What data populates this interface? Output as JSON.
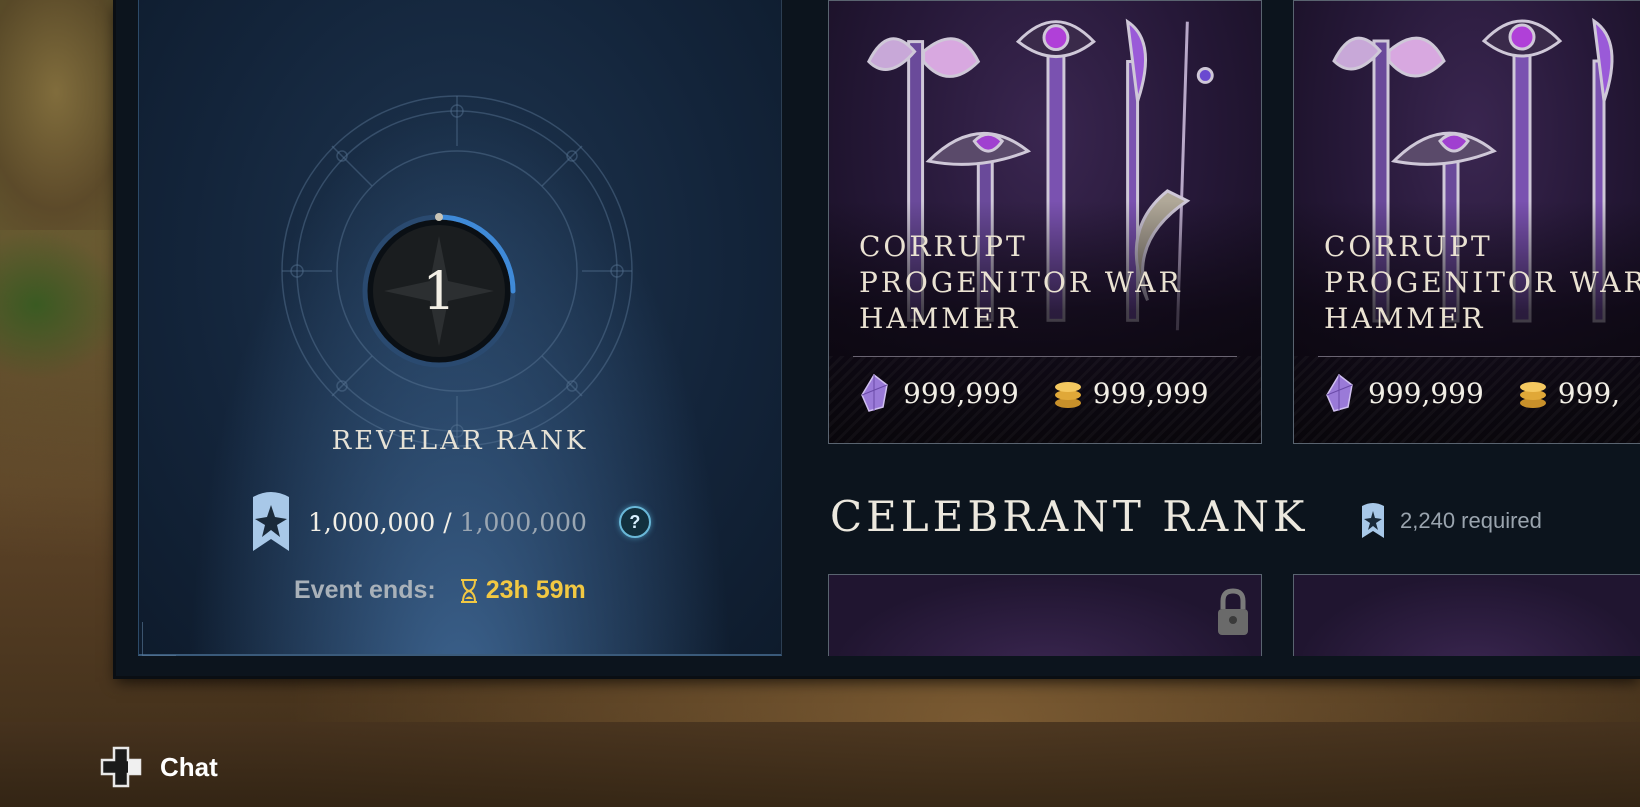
{
  "revelar": {
    "rank_number": "1",
    "rank_label": "REVELAR RANK",
    "progress_current": "1,000,000",
    "progress_separator": "/",
    "progress_max": "1,000,000",
    "help_symbol": "?",
    "event_label": "Event ends:",
    "event_time": "23h 59m",
    "progress_fraction": 0.25
  },
  "items": [
    {
      "name": "CORRUPT PROGENITOR WAR HAMMER",
      "gem_price": "999,999",
      "coin_price": "999,999"
    },
    {
      "name": "CORRUPT PROGENITOR WAR HAMMER",
      "gem_price": "999,999",
      "coin_price": "999,"
    }
  ],
  "celebrant": {
    "title": "CELEBRANT RANK",
    "requirement": "2,240 required"
  },
  "footer": {
    "chat_label": "Chat"
  },
  "icons": {
    "rank_badge": "rank-badge-icon",
    "help": "help-icon",
    "hourglass": "hourglass-icon",
    "gem": "gem-icon",
    "coin": "coin-icon",
    "lock": "lock-icon",
    "dpad": "dpad-icon"
  },
  "colors": {
    "accent_gold": "#f2c842",
    "accent_blue": "#4a9ad8",
    "panel_blue": "#1e3550",
    "item_purple": "#3a2650"
  }
}
